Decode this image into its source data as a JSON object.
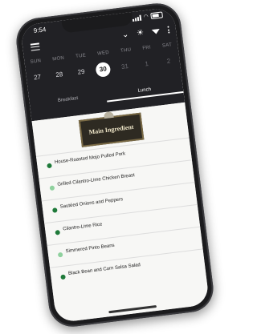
{
  "status": {
    "time": "9:54"
  },
  "days": [
    "SUN",
    "MON",
    "TUE",
    "WED",
    "THU",
    "FRI",
    "SAT"
  ],
  "dates": [
    {
      "label": "27",
      "state": "normal"
    },
    {
      "label": "28",
      "state": "normal"
    },
    {
      "label": "29",
      "state": "normal"
    },
    {
      "label": "30",
      "state": "selected"
    },
    {
      "label": "31",
      "state": "dim"
    },
    {
      "label": "1",
      "state": "dim"
    },
    {
      "label": "2",
      "state": "dim"
    }
  ],
  "meals": [
    {
      "label": "Breakfast",
      "active": false
    },
    {
      "label": "Lunch",
      "active": true
    }
  ],
  "logo_text": "Main Ingredient",
  "items": [
    {
      "text": "House-Roasted Mojo Pulled Pork",
      "dot": "#1f7a3a"
    },
    {
      "text": "Grilled Cilantro-Lime Chicken Breast",
      "dot": "#8fd19e"
    },
    {
      "text": "Sautéed Onions and Peppers",
      "dot": "#1f7a3a"
    },
    {
      "text": "Cilantro-Lime Rice",
      "dot": "#1f7a3a"
    },
    {
      "text": "Simmered Pinto Beans",
      "dot": "#8fd19e"
    },
    {
      "text": "Black Bean and Corn Salsa Salad",
      "dot": "#1f7a3a"
    }
  ]
}
